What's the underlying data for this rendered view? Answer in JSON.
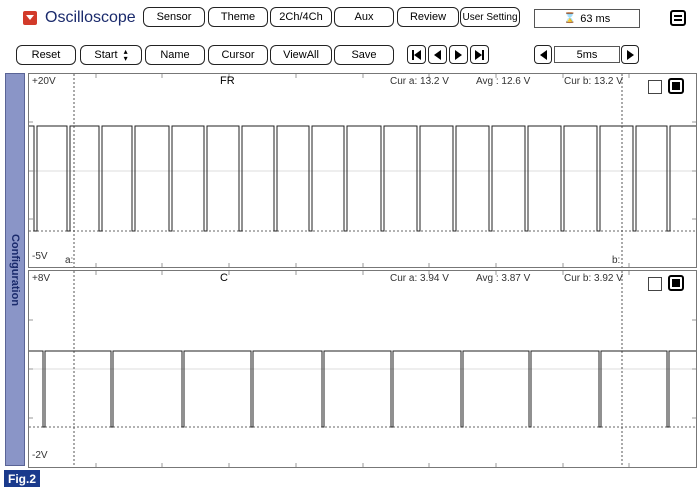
{
  "app": {
    "title": "Oscilloscope"
  },
  "toolbar_top": {
    "sensor": "Sensor",
    "theme": "Theme",
    "channels": "2Ch/4Ch",
    "aux": "Aux",
    "review": "Review",
    "user_setting": "User Setting",
    "sample_time": "63 ms"
  },
  "toolbar_second": {
    "reset": "Reset",
    "start": "Start",
    "name": "Name",
    "cursor": "Cursor",
    "view_all": "ViewAll",
    "save": "Save",
    "timebase": "5ms"
  },
  "sidebar": {
    "label": "Configuration"
  },
  "channel1": {
    "title": "FR",
    "y_max": "+20V",
    "y_min": "-5V",
    "cur_a": "Cur a: 13.2 V",
    "avg": "Avg : 12.6 V",
    "cur_b": "Cur b: 13.2 V",
    "marker_a": "a:",
    "marker_b": "b:"
  },
  "channel2": {
    "title": "C",
    "y_max": "+8V",
    "y_min": "-2V",
    "cur_a": "Cur a: 3.94 V",
    "avg": "Avg : 3.87 V",
    "cur_b": "Cur b: 3.92 V"
  },
  "figure_label": "Fig.2",
  "colors": {
    "accent": "#1a3a8c",
    "sidebar": "#8a95c7",
    "menu_red": "#c0392b"
  }
}
